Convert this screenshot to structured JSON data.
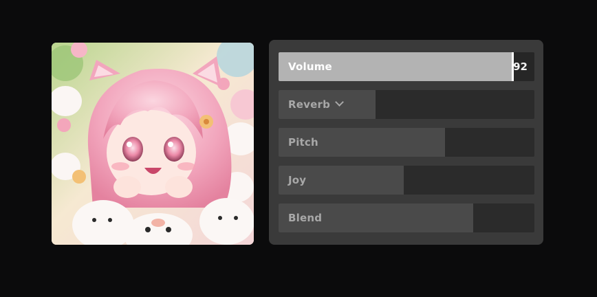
{
  "artwork": {
    "subject": "pink-haired anime cat girl with white kittens and flowers"
  },
  "controls": [
    {
      "label": "Volume",
      "value": 92,
      "value_text": "92",
      "active": true,
      "has_dropdown": false
    },
    {
      "label": "Reverb",
      "value": 38,
      "active": false,
      "has_dropdown": true
    },
    {
      "label": "Pitch",
      "value": 65,
      "active": false,
      "has_dropdown": false
    },
    {
      "label": "Joy",
      "value": 49,
      "active": false,
      "has_dropdown": false
    },
    {
      "label": "Blend",
      "value": 76,
      "active": false,
      "has_dropdown": false
    }
  ],
  "colors": {
    "page_background": "#0b0b0c",
    "panel_background": "#3a3a3a",
    "track": "#2b2b2b",
    "fill": "#4a4a4a",
    "active_fill": "#b3b3b3",
    "handle": "#ffffff"
  },
  "icons": {
    "reverb_dropdown": "chevron-down-icon"
  }
}
